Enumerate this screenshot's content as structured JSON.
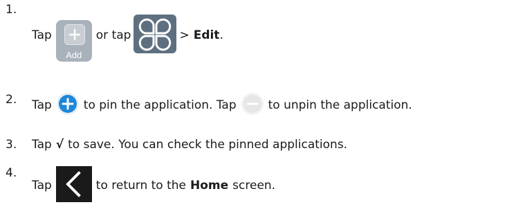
{
  "steps": [
    {
      "number": "1.",
      "tap": "Tap",
      "add_label": "Add",
      "or_tap": "or tap",
      "arrow": ">",
      "edit": "Edit",
      "end": "."
    },
    {
      "number": "2.",
      "tap": "Tap",
      "pin_text": "to pin the application. Tap",
      "unpin_text": "to unpin the application."
    },
    {
      "number": "3.",
      "tap": "Tap",
      "check": "√",
      "rest": "to save. You can check the pinned applications."
    },
    {
      "number": "4.",
      "tap": "Tap",
      "return_text": "to return to the",
      "home": "Home",
      "screen_text": "screen."
    }
  ],
  "icons": {
    "add": "add-tile-icon",
    "apps": "app-grid-clover-icon",
    "pin": "pin-plus-icon",
    "unpin": "unpin-minus-icon",
    "back": "back-chevron-icon"
  },
  "colors": {
    "pin_blue": "#1e87d9",
    "tile_gray": "#a9b1bb",
    "clover_gray": "#5e6f80",
    "unpin_gray": "#e6e6e6",
    "back_bg": "#1a1a1a"
  }
}
